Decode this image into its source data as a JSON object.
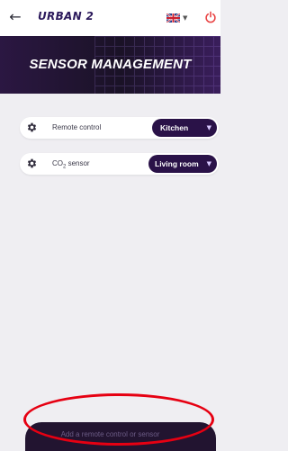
{
  "header": {
    "brand": "URBAN 2",
    "back_icon": "arrow-left-icon",
    "language_icon": "uk-flag-icon",
    "power_icon": "power-icon"
  },
  "banner": {
    "title": "SENSOR MANAGEMENT"
  },
  "sensors": [
    {
      "label": "Remote control",
      "icon": "gear-icon",
      "room": "Kitchen"
    },
    {
      "label_main": "CO",
      "label_sub": "2",
      "label_rest": " sensor",
      "icon": "gear-icon",
      "room": "Living room"
    }
  ],
  "footer": {
    "add_button_label": "Add a remote control or sensor"
  },
  "colors": {
    "accent": "#2a1248",
    "banner_dark": "#1a1226",
    "annotation": "#e60012",
    "power": "#e84040"
  }
}
